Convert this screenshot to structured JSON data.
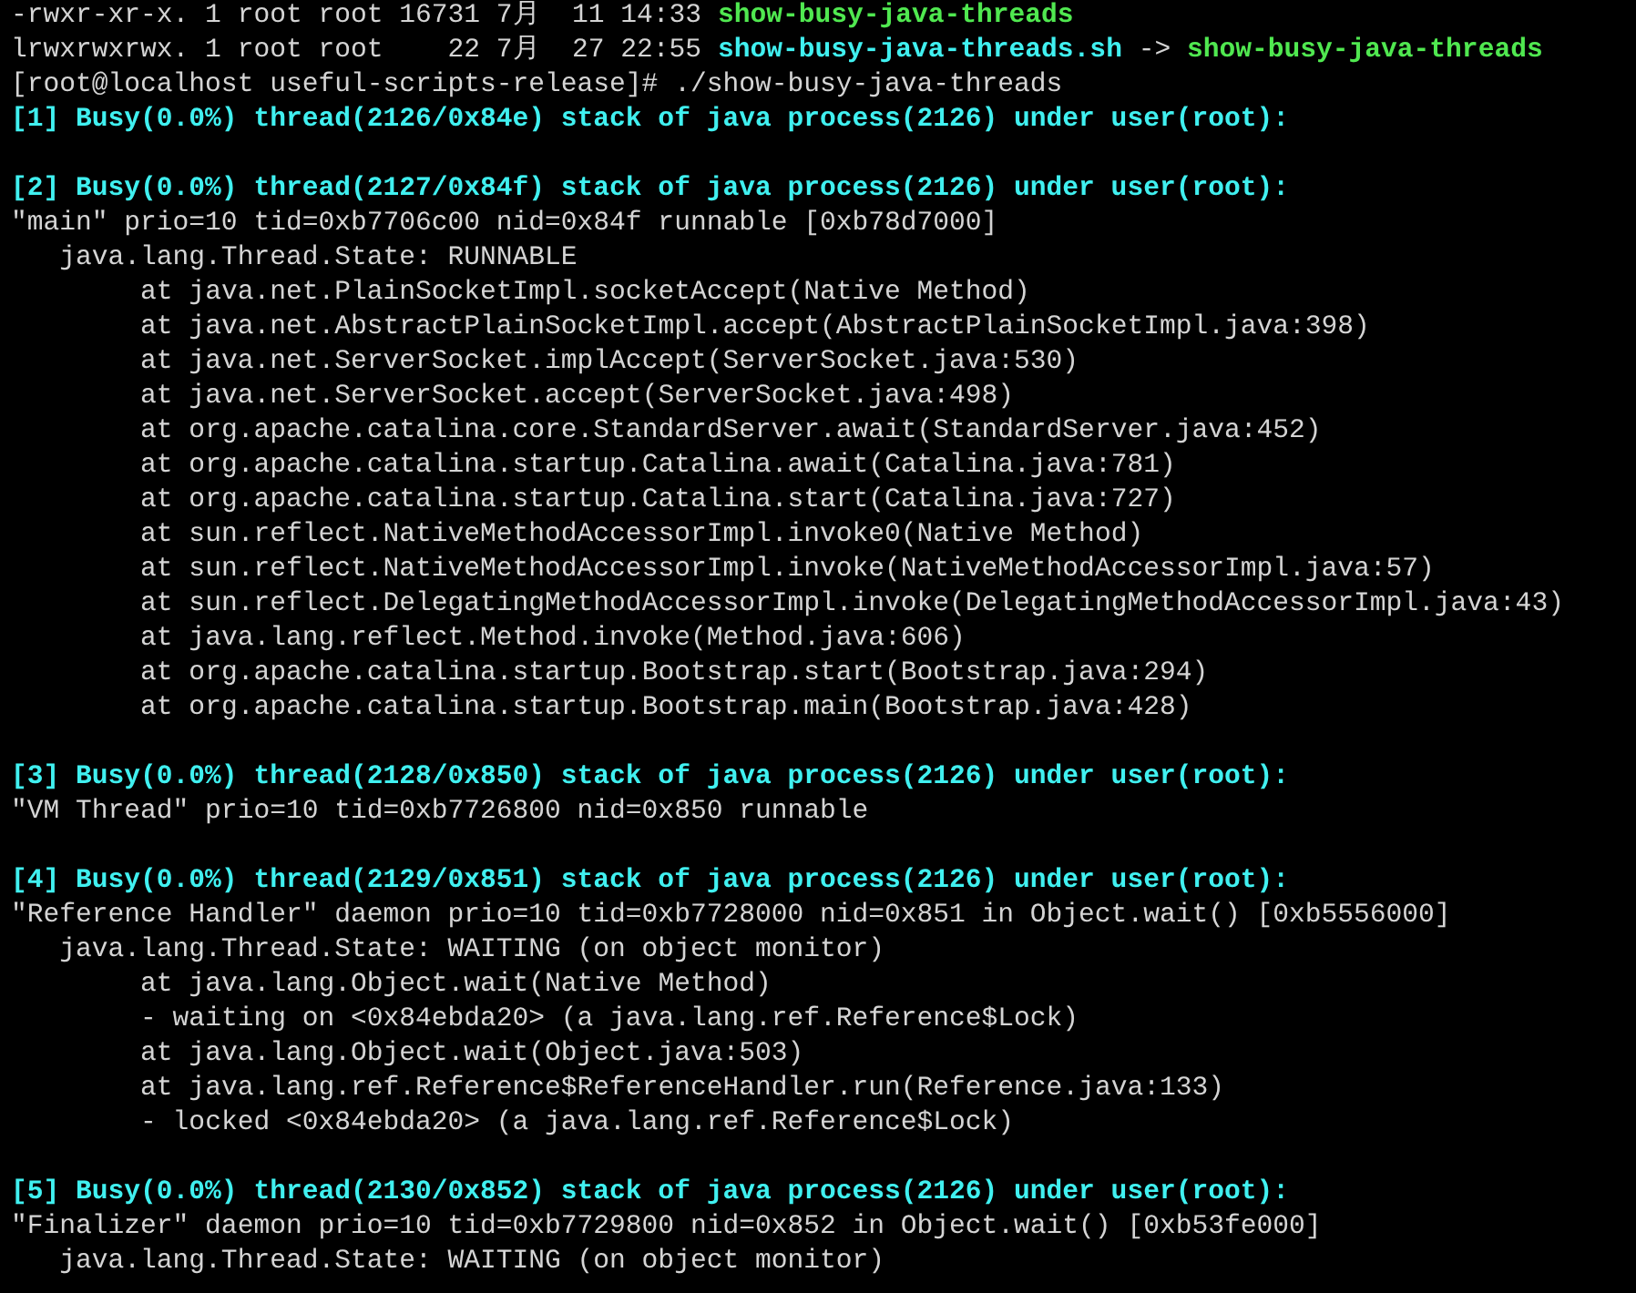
{
  "terminal": {
    "lines": [
      {
        "kind": "text",
        "segments": [
          {
            "text": "-rwxr-xr-x. 1 root root 16731 7月  11 14:33 ",
            "kind": "plain"
          },
          {
            "text": "show-busy-java-threads",
            "kind": "executable"
          }
        ]
      },
      {
        "kind": "text",
        "segments": [
          {
            "text": "lrwxrwxrwx. 1 root root    22 7月  27 22:55 ",
            "kind": "plain"
          },
          {
            "text": "show-busy-java-threads.sh",
            "kind": "symlink"
          },
          {
            "text": " -> ",
            "kind": "plain"
          },
          {
            "text": "show-busy-java-threads",
            "kind": "executable"
          }
        ]
      },
      {
        "kind": "text",
        "segments": [
          {
            "text": "[root@localhost useful-scripts-release]# ./show-busy-java-threads",
            "kind": "plain"
          }
        ]
      },
      {
        "kind": "text",
        "segments": [
          {
            "text": "[1] Busy(0.0%) thread(2126/0x84e) stack of java process(2126) under user(root):",
            "kind": "heading"
          }
        ]
      },
      {
        "kind": "blank"
      },
      {
        "kind": "text",
        "segments": [
          {
            "text": "[2] Busy(0.0%) thread(2127/0x84f) stack of java process(2126) under user(root):",
            "kind": "heading"
          }
        ]
      },
      {
        "kind": "text",
        "segments": [
          {
            "text": "\"main\" prio=10 tid=0xb7706c00 nid=0x84f runnable [0xb78d7000]",
            "kind": "plain"
          }
        ]
      },
      {
        "kind": "text",
        "segments": [
          {
            "text": "   java.lang.Thread.State: RUNNABLE",
            "kind": "plain"
          }
        ]
      },
      {
        "kind": "text",
        "segments": [
          {
            "text": "\tat java.net.PlainSocketImpl.socketAccept(Native Method)",
            "kind": "plain"
          }
        ]
      },
      {
        "kind": "text",
        "segments": [
          {
            "text": "\tat java.net.AbstractPlainSocketImpl.accept(AbstractPlainSocketImpl.java:398)",
            "kind": "plain"
          }
        ]
      },
      {
        "kind": "text",
        "segments": [
          {
            "text": "\tat java.net.ServerSocket.implAccept(ServerSocket.java:530)",
            "kind": "plain"
          }
        ]
      },
      {
        "kind": "text",
        "segments": [
          {
            "text": "\tat java.net.ServerSocket.accept(ServerSocket.java:498)",
            "kind": "plain"
          }
        ]
      },
      {
        "kind": "text",
        "segments": [
          {
            "text": "\tat org.apache.catalina.core.StandardServer.await(StandardServer.java:452)",
            "kind": "plain"
          }
        ]
      },
      {
        "kind": "text",
        "segments": [
          {
            "text": "\tat org.apache.catalina.startup.Catalina.await(Catalina.java:781)",
            "kind": "plain"
          }
        ]
      },
      {
        "kind": "text",
        "segments": [
          {
            "text": "\tat org.apache.catalina.startup.Catalina.start(Catalina.java:727)",
            "kind": "plain"
          }
        ]
      },
      {
        "kind": "text",
        "segments": [
          {
            "text": "\tat sun.reflect.NativeMethodAccessorImpl.invoke0(Native Method)",
            "kind": "plain"
          }
        ]
      },
      {
        "kind": "text",
        "segments": [
          {
            "text": "\tat sun.reflect.NativeMethodAccessorImpl.invoke(NativeMethodAccessorImpl.java:57)",
            "kind": "plain"
          }
        ]
      },
      {
        "kind": "text",
        "segments": [
          {
            "text": "\tat sun.reflect.DelegatingMethodAccessorImpl.invoke(DelegatingMethodAccessorImpl.java:43)",
            "kind": "plain"
          }
        ]
      },
      {
        "kind": "text",
        "segments": [
          {
            "text": "\tat java.lang.reflect.Method.invoke(Method.java:606)",
            "kind": "plain"
          }
        ]
      },
      {
        "kind": "text",
        "segments": [
          {
            "text": "\tat org.apache.catalina.startup.Bootstrap.start(Bootstrap.java:294)",
            "kind": "plain"
          }
        ]
      },
      {
        "kind": "text",
        "segments": [
          {
            "text": "\tat org.apache.catalina.startup.Bootstrap.main(Bootstrap.java:428)",
            "kind": "plain"
          }
        ]
      },
      {
        "kind": "blank"
      },
      {
        "kind": "text",
        "segments": [
          {
            "text": "[3] Busy(0.0%) thread(2128/0x850) stack of java process(2126) under user(root):",
            "kind": "heading"
          }
        ]
      },
      {
        "kind": "text",
        "segments": [
          {
            "text": "\"VM Thread\" prio=10 tid=0xb7726800 nid=0x850 runnable",
            "kind": "plain"
          }
        ]
      },
      {
        "kind": "blank"
      },
      {
        "kind": "text",
        "segments": [
          {
            "text": "[4] Busy(0.0%) thread(2129/0x851) stack of java process(2126) under user(root):",
            "kind": "heading"
          }
        ]
      },
      {
        "kind": "text",
        "segments": [
          {
            "text": "\"Reference Handler\" daemon prio=10 tid=0xb7728000 nid=0x851 in Object.wait() [0xb5556000]",
            "kind": "plain"
          }
        ]
      },
      {
        "kind": "text",
        "segments": [
          {
            "text": "   java.lang.Thread.State: WAITING (on object monitor)",
            "kind": "plain"
          }
        ]
      },
      {
        "kind": "text",
        "segments": [
          {
            "text": "\tat java.lang.Object.wait(Native Method)",
            "kind": "plain"
          }
        ]
      },
      {
        "kind": "text",
        "segments": [
          {
            "text": "\t- waiting on <0x84ebda20> (a java.lang.ref.Reference$Lock)",
            "kind": "plain"
          }
        ]
      },
      {
        "kind": "text",
        "segments": [
          {
            "text": "\tat java.lang.Object.wait(Object.java:503)",
            "kind": "plain"
          }
        ]
      },
      {
        "kind": "text",
        "segments": [
          {
            "text": "\tat java.lang.ref.Reference$ReferenceHandler.run(Reference.java:133)",
            "kind": "plain"
          }
        ]
      },
      {
        "kind": "text",
        "segments": [
          {
            "text": "\t- locked <0x84ebda20> (a java.lang.ref.Reference$Lock)",
            "kind": "plain"
          }
        ]
      },
      {
        "kind": "blank"
      },
      {
        "kind": "text",
        "segments": [
          {
            "text": "[5] Busy(0.0%) thread(2130/0x852) stack of java process(2126) under user(root):",
            "kind": "heading"
          }
        ]
      },
      {
        "kind": "text",
        "segments": [
          {
            "text": "\"Finalizer\" daemon prio=10 tid=0xb7729800 nid=0x852 in Object.wait() [0xb53fe000]",
            "kind": "plain"
          }
        ]
      },
      {
        "kind": "text",
        "segments": [
          {
            "text": "   java.lang.Thread.State: WAITING (on object monitor)",
            "kind": "plain"
          }
        ]
      }
    ]
  }
}
